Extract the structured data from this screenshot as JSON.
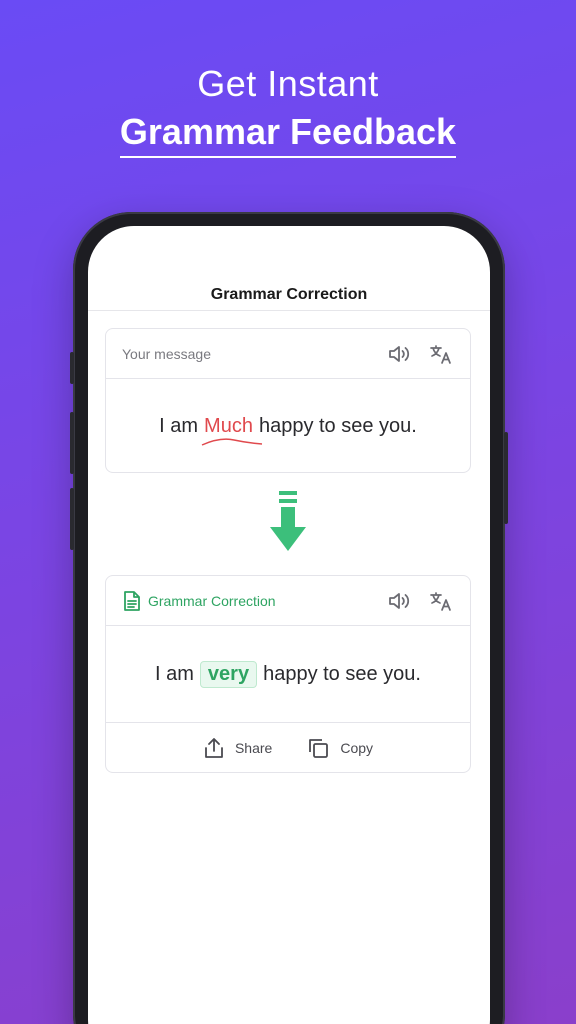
{
  "headline": {
    "line1": "Get Instant",
    "line2": "Grammar Feedback"
  },
  "app": {
    "title": "Grammar Correction"
  },
  "input_card": {
    "label": "Your message",
    "text_before": "I am",
    "error_word": "Much",
    "text_after": "happy to see you."
  },
  "output_card": {
    "label": "Grammar Correction",
    "text_before": "I am",
    "corrected_word": "very",
    "text_after": "happy to see you."
  },
  "actions": {
    "share_label": "Share",
    "copy_label": "Copy"
  },
  "icons": [
    "speaker-icon",
    "translate-icon",
    "document-icon",
    "arrow-down-icon",
    "share-icon",
    "copy-icon"
  ],
  "colors": {
    "accent_green": "#2ea462",
    "error_red": "#e0494d",
    "background_top": "#6a4bf5",
    "background_bottom": "#8a3fcb"
  }
}
